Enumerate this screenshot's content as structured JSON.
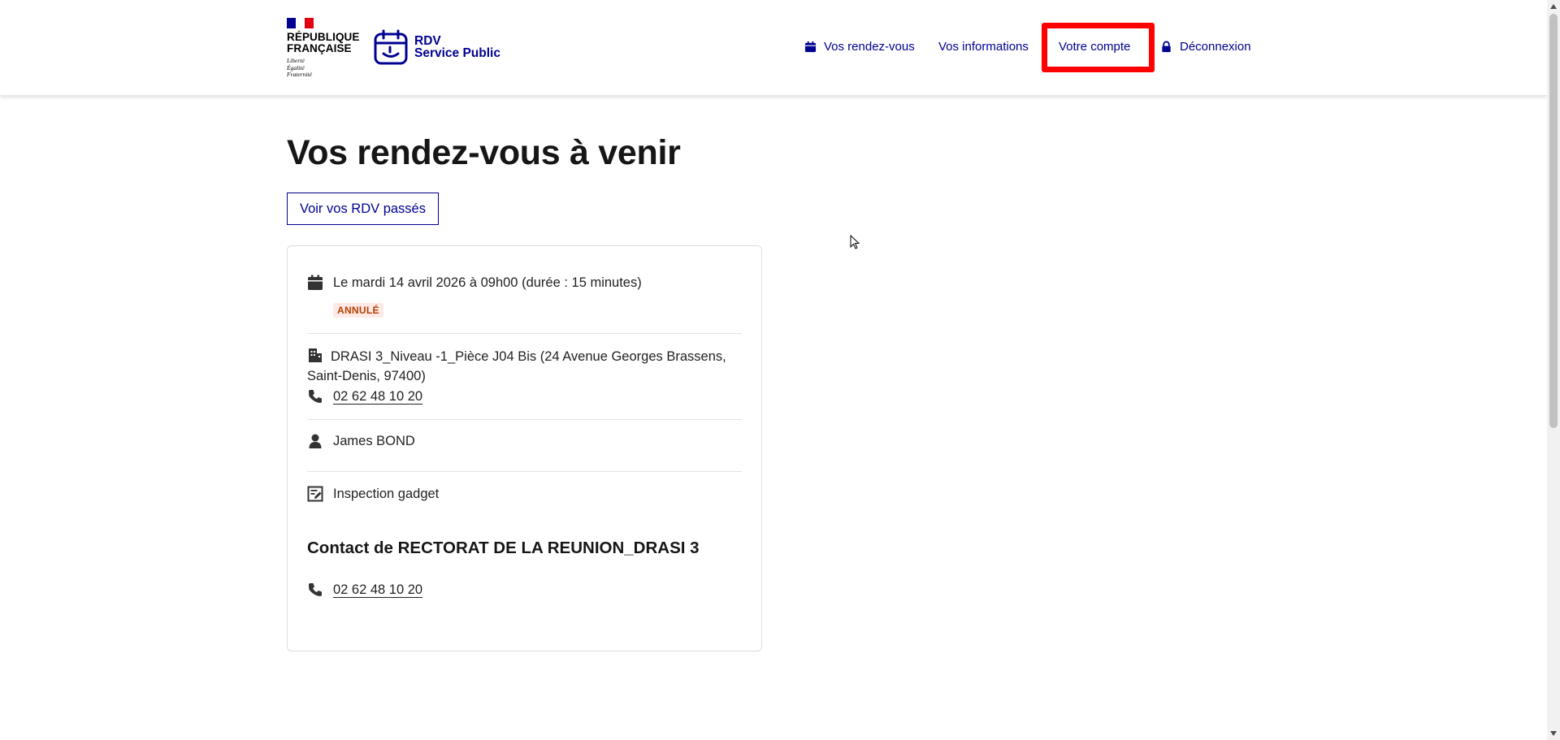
{
  "header": {
    "republique_line1": "RÉPUBLIQUE",
    "republique_line2": "FRANÇAISE",
    "motto_1": "Liberté",
    "motto_2": "Égalité",
    "motto_3": "Fraternité",
    "service_line1": "RDV",
    "service_line2": "Service Public"
  },
  "nav": {
    "items": [
      {
        "label": "Vos rendez-vous",
        "icon": "calendar-icon"
      },
      {
        "label": "Vos informations",
        "icon": ""
      },
      {
        "label": "Votre compte",
        "icon": ""
      },
      {
        "label": "Déconnexion",
        "icon": "lock-icon"
      }
    ],
    "highlight_color": "#ff0000"
  },
  "main": {
    "title": "Vos rendez-vous à venir",
    "past_button": "Voir vos RDV passés"
  },
  "appointment": {
    "date_text": "Le mardi 14 avril 2026 à 09h00 (durée : 15 minutes)",
    "status_badge": "ANNULÉ",
    "address_line1": "DRASI 3_Niveau -1_Pièce J04 Bis (24 Avenue Georges Brassens,",
    "address_line2": "Saint-Denis, 97400)",
    "phone": " 02 62 48 10 20",
    "agent": "James BOND",
    "motif": "Inspection gadget",
    "contact_title": "Contact de RECTORAT DE LA REUNION_DRASI 3",
    "contact_phone": " 02 62 48 10 20"
  },
  "colors": {
    "primary": "#000091",
    "badge_bg": "#ffe9e6",
    "badge_text": "#b34000",
    "rf_red": "#e1000f"
  }
}
